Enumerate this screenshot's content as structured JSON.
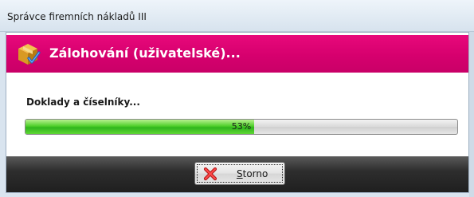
{
  "window": {
    "title": "Správce firemních nákladů III"
  },
  "banner": {
    "title": "Zálohování (uživatelské)...",
    "icon": "backup-box-check-icon",
    "color": "#d6006e"
  },
  "content": {
    "status_text": "Doklady a číselníky..."
  },
  "progress": {
    "percent": 53,
    "label": "53%"
  },
  "footer": {
    "cancel_button": {
      "label_first": "S",
      "label_rest": "torno",
      "icon": "red-x-icon"
    }
  }
}
